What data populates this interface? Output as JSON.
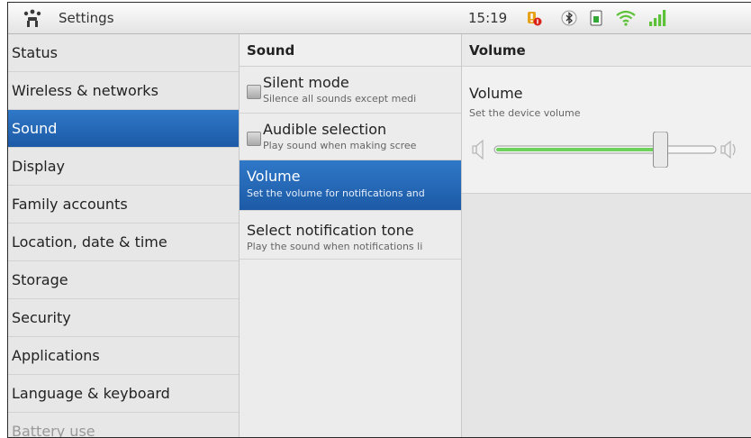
{
  "statusbar": {
    "app_title": "Settings",
    "time": "15:19",
    "icons": [
      "app-icon",
      "alert-icon",
      "bluetooth-icon",
      "sim-icon",
      "wifi-icon",
      "signal-icon"
    ]
  },
  "categories": [
    {
      "label": "Status",
      "selected": false
    },
    {
      "label": "Wireless & networks",
      "selected": false
    },
    {
      "label": "Sound",
      "selected": true
    },
    {
      "label": "Display",
      "selected": false
    },
    {
      "label": "Family accounts",
      "selected": false
    },
    {
      "label": "Location, date & time",
      "selected": false
    },
    {
      "label": "Storage",
      "selected": false
    },
    {
      "label": "Security",
      "selected": false
    },
    {
      "label": "Applications",
      "selected": false
    },
    {
      "label": "Language & keyboard",
      "selected": false
    },
    {
      "label": "Battery use",
      "selected": false
    }
  ],
  "sound": {
    "header": "Sound",
    "items": [
      {
        "title": "Silent mode",
        "summary": "Silence all sounds except medi",
        "checked": false
      },
      {
        "title": "Audible selection",
        "summary": "Play sound when making scree",
        "checked": false
      },
      {
        "title": "Volume",
        "summary": "Set the volume for notifications and"
      },
      {
        "title": "Select notification tone",
        "summary": "Play the sound when notifications li"
      }
    ]
  },
  "volume": {
    "header": "Volume",
    "title": "Volume",
    "summary": "Set the device volume",
    "level": 0.75
  },
  "colors": {
    "accent": "#2468b8",
    "slider_fill": "#6ed15c"
  }
}
